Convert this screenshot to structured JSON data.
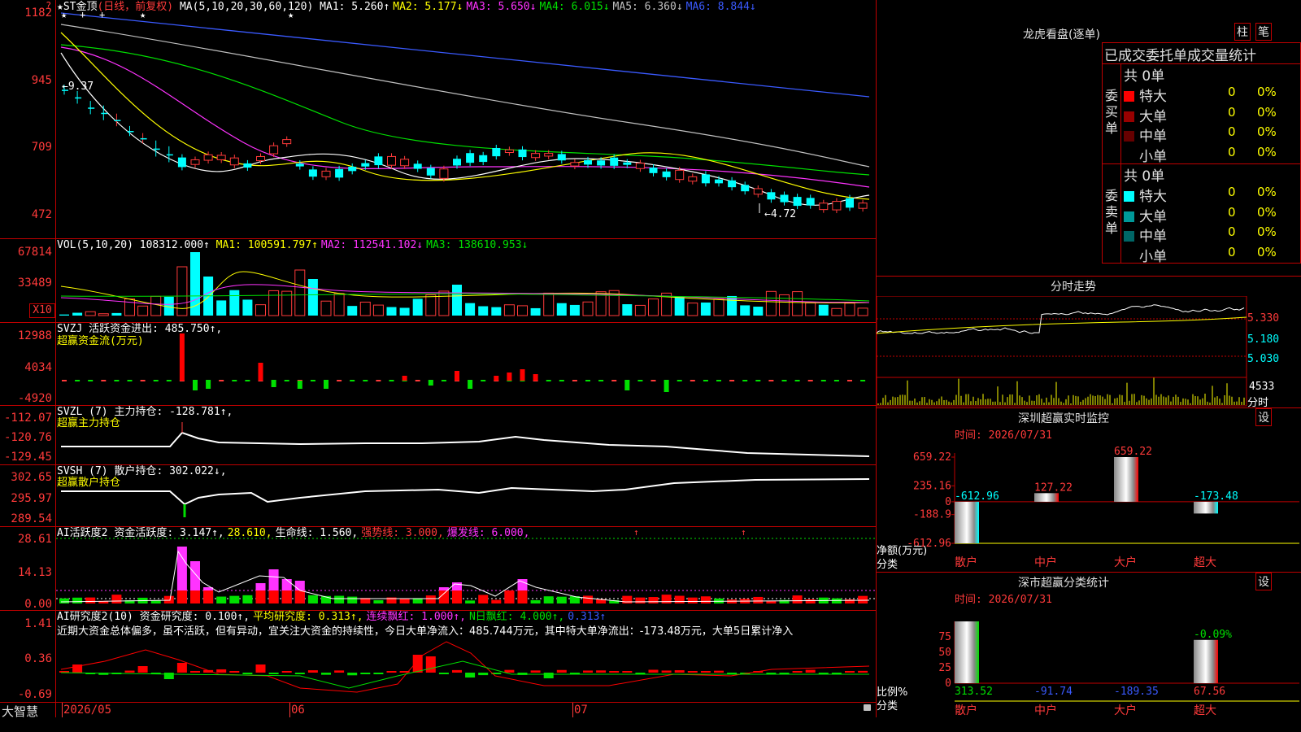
{
  "stock": {
    "title": "★ST金顶",
    "period_note": "(日线，前复权)",
    "ma_label": "MA(5,10,20,30,60,120)",
    "ma_values": [
      {
        "label": "MA1: 5.260↑",
        "color": "#ffffff"
      },
      {
        "label": "MA2: 5.177↓",
        "color": "#ffff00"
      },
      {
        "label": "MA3: 5.650↓",
        "color": "#ff33ff"
      },
      {
        "label": "MA4: 6.015↓",
        "color": "#00e000"
      },
      {
        "label": "MA5: 6.360↓",
        "color": "#c0c0c0"
      },
      {
        "label": "MA6: 8.844↓",
        "color": "#3a5aff"
      }
    ],
    "y_ticks": [
      "1182",
      "945",
      "709",
      "472"
    ],
    "high_marker": "←9.37",
    "low_marker": "←4.72",
    "lock_icon": "lock-icon"
  },
  "vol": {
    "title": "VOL(5,10,20)",
    "value": "108312.000↑",
    "ma_values": [
      {
        "label": "MA1: 100591.797↑",
        "color": "#ffff00"
      },
      {
        "label": "MA2: 112541.102↓",
        "color": "#ff33ff"
      },
      {
        "label": "MA3: 138610.953↓",
        "color": "#00e000"
      }
    ],
    "y_ticks": [
      "67814",
      "33489"
    ],
    "unit": "X10"
  },
  "svzj": {
    "title": "SVZJ  活跃资金进出: 485.750↑,",
    "subtitle": "超赢资金流(万元)",
    "y_ticks": [
      "12988",
      "4034",
      "-4920"
    ]
  },
  "svzl": {
    "title": "SVZL (7) 主力持仓: -128.781↑,",
    "subtitle": "超赢主力持仓",
    "y_ticks": [
      "-112.07",
      "-120.76",
      "-129.45"
    ]
  },
  "svsh": {
    "title": "SVSH (7) 散户持仓: 302.022↓,",
    "subtitle": "超赢散户持仓",
    "y_ticks": [
      "302.65",
      "295.97",
      "289.54"
    ]
  },
  "ai_active": {
    "title": "AI活跃度2",
    "items": [
      {
        "label": "资金活跃度: 3.147↑,",
        "color": "#ffffff"
      },
      {
        "label": "28.610,",
        "color": "#ffff00"
      },
      {
        "label": "生命线: 1.560,",
        "color": "#ffffff"
      },
      {
        "label": "强势线: 3.000,",
        "color": "#ff3a3a"
      },
      {
        "label": "爆发线: 6.000,",
        "color": "#ff33ff"
      }
    ],
    "y_ticks": [
      "28.61",
      "14.13",
      "0.00"
    ]
  },
  "ai_research": {
    "title": "AI研究度2(10)",
    "items": [
      {
        "label": "资金研究度: 0.100↑,",
        "color": "#ffffff"
      },
      {
        "label": "平均研究度: 0.313↑,",
        "color": "#ffff00"
      },
      {
        "label": "连续飘红: 1.000↑,",
        "color": "#ff33ff"
      },
      {
        "label": "N日飘红: 4.000↑,",
        "color": "#00e000"
      },
      {
        "label": "0.313↑",
        "color": "#3a5aff"
      }
    ],
    "comment": "近期大资金总体偏多，虽不活跃，但有异动，宜关注大资金的持续性，今日大单净流入：485.744万元，其中特大单净流出：-173.48万元，大单5日累计净入",
    "y_ticks": [
      "1.41",
      "0.36",
      "-0.69"
    ]
  },
  "footer": {
    "brand": "大智慧",
    "dates": [
      "2026/05",
      "06",
      "07"
    ]
  },
  "dragon": {
    "title": "龙虎看盘(逐单)",
    "btn_bar": "柱",
    "btn_pen": "笔",
    "header": "已成交委托单成交量统计",
    "buy_label": "委买单",
    "sell_label": "委卖单",
    "buy_total": "共 0单",
    "sell_total": "共 0单",
    "buy_rows": [
      {
        "name": "特大",
        "count": "0",
        "pct": "0%",
        "color": "#ff0000"
      },
      {
        "name": "大单",
        "count": "0",
        "pct": "0%",
        "color": "#990000"
      },
      {
        "name": "中单",
        "count": "0",
        "pct": "0%",
        "color": "#660000"
      },
      {
        "name": "小单",
        "count": "0",
        "pct": "0%",
        "color": "#000000"
      }
    ],
    "sell_rows": [
      {
        "name": "特大",
        "count": "0",
        "pct": "0%",
        "color": "#00ffff"
      },
      {
        "name": "大单",
        "count": "0",
        "pct": "0%",
        "color": "#009999"
      },
      {
        "name": "中单",
        "count": "0",
        "pct": "0%",
        "color": "#006666"
      },
      {
        "name": "小单",
        "count": "0",
        "pct": "0%",
        "color": "#000000"
      }
    ]
  },
  "intraday": {
    "title": "分时走势",
    "price_ticks": [
      "5.330",
      "5.180",
      "5.030"
    ],
    "vol_tick": "4533",
    "vol_label": "分时"
  },
  "sz_monitor": {
    "title": "深圳超赢实时监控",
    "btn": "设",
    "time": "时间: 2026/07/31",
    "y_ticks": [
      "659.22",
      "235.16",
      "0",
      "-188.9",
      "-612.96"
    ],
    "axis_label": "净额(万元)",
    "cat_label": "分类",
    "categories": [
      "散户",
      "中户",
      "大户",
      "超大"
    ],
    "values": [
      -612.96,
      127.22,
      659.22,
      -173.48
    ],
    "value_labels": [
      "-612.96",
      "127.22",
      "659.22",
      "-173.48"
    ]
  },
  "sz_class": {
    "title": "深市超赢分类统计",
    "btn": "设",
    "time": "时间: 2026/07/31",
    "y_ticks": [
      "75",
      "50",
      "25",
      "0"
    ],
    "axis_label": "比例%",
    "cat_label": "分类",
    "categories": [
      "散户",
      "中户",
      "大户",
      "超大"
    ],
    "bottom_values": [
      "313.52",
      "-91.74",
      "-189.35",
      "67.56"
    ],
    "pct_labels": [
      "",
      "",
      "",
      "-0.09%"
    ]
  }
}
